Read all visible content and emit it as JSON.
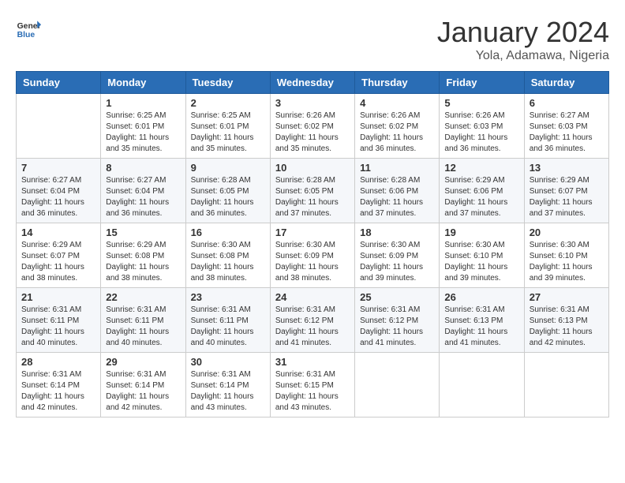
{
  "header": {
    "logo_line1": "General",
    "logo_line2": "Blue",
    "title": "January 2024",
    "subtitle": "Yola, Adamawa, Nigeria"
  },
  "calendar": {
    "days_of_week": [
      "Sunday",
      "Monday",
      "Tuesday",
      "Wednesday",
      "Thursday",
      "Friday",
      "Saturday"
    ],
    "weeks": [
      [
        {
          "day": "",
          "info": ""
        },
        {
          "day": "1",
          "info": "Sunrise: 6:25 AM\nSunset: 6:01 PM\nDaylight: 11 hours and 35 minutes."
        },
        {
          "day": "2",
          "info": "Sunrise: 6:25 AM\nSunset: 6:01 PM\nDaylight: 11 hours and 35 minutes."
        },
        {
          "day": "3",
          "info": "Sunrise: 6:26 AM\nSunset: 6:02 PM\nDaylight: 11 hours and 35 minutes."
        },
        {
          "day": "4",
          "info": "Sunrise: 6:26 AM\nSunset: 6:02 PM\nDaylight: 11 hours and 36 minutes."
        },
        {
          "day": "5",
          "info": "Sunrise: 6:26 AM\nSunset: 6:03 PM\nDaylight: 11 hours and 36 minutes."
        },
        {
          "day": "6",
          "info": "Sunrise: 6:27 AM\nSunset: 6:03 PM\nDaylight: 11 hours and 36 minutes."
        }
      ],
      [
        {
          "day": "7",
          "info": "Sunrise: 6:27 AM\nSunset: 6:04 PM\nDaylight: 11 hours and 36 minutes."
        },
        {
          "day": "8",
          "info": "Sunrise: 6:27 AM\nSunset: 6:04 PM\nDaylight: 11 hours and 36 minutes."
        },
        {
          "day": "9",
          "info": "Sunrise: 6:28 AM\nSunset: 6:05 PM\nDaylight: 11 hours and 36 minutes."
        },
        {
          "day": "10",
          "info": "Sunrise: 6:28 AM\nSunset: 6:05 PM\nDaylight: 11 hours and 37 minutes."
        },
        {
          "day": "11",
          "info": "Sunrise: 6:28 AM\nSunset: 6:06 PM\nDaylight: 11 hours and 37 minutes."
        },
        {
          "day": "12",
          "info": "Sunrise: 6:29 AM\nSunset: 6:06 PM\nDaylight: 11 hours and 37 minutes."
        },
        {
          "day": "13",
          "info": "Sunrise: 6:29 AM\nSunset: 6:07 PM\nDaylight: 11 hours and 37 minutes."
        }
      ],
      [
        {
          "day": "14",
          "info": "Sunrise: 6:29 AM\nSunset: 6:07 PM\nDaylight: 11 hours and 38 minutes."
        },
        {
          "day": "15",
          "info": "Sunrise: 6:29 AM\nSunset: 6:08 PM\nDaylight: 11 hours and 38 minutes."
        },
        {
          "day": "16",
          "info": "Sunrise: 6:30 AM\nSunset: 6:08 PM\nDaylight: 11 hours and 38 minutes."
        },
        {
          "day": "17",
          "info": "Sunrise: 6:30 AM\nSunset: 6:09 PM\nDaylight: 11 hours and 38 minutes."
        },
        {
          "day": "18",
          "info": "Sunrise: 6:30 AM\nSunset: 6:09 PM\nDaylight: 11 hours and 39 minutes."
        },
        {
          "day": "19",
          "info": "Sunrise: 6:30 AM\nSunset: 6:10 PM\nDaylight: 11 hours and 39 minutes."
        },
        {
          "day": "20",
          "info": "Sunrise: 6:30 AM\nSunset: 6:10 PM\nDaylight: 11 hours and 39 minutes."
        }
      ],
      [
        {
          "day": "21",
          "info": "Sunrise: 6:31 AM\nSunset: 6:11 PM\nDaylight: 11 hours and 40 minutes."
        },
        {
          "day": "22",
          "info": "Sunrise: 6:31 AM\nSunset: 6:11 PM\nDaylight: 11 hours and 40 minutes."
        },
        {
          "day": "23",
          "info": "Sunrise: 6:31 AM\nSunset: 6:11 PM\nDaylight: 11 hours and 40 minutes."
        },
        {
          "day": "24",
          "info": "Sunrise: 6:31 AM\nSunset: 6:12 PM\nDaylight: 11 hours and 41 minutes."
        },
        {
          "day": "25",
          "info": "Sunrise: 6:31 AM\nSunset: 6:12 PM\nDaylight: 11 hours and 41 minutes."
        },
        {
          "day": "26",
          "info": "Sunrise: 6:31 AM\nSunset: 6:13 PM\nDaylight: 11 hours and 41 minutes."
        },
        {
          "day": "27",
          "info": "Sunrise: 6:31 AM\nSunset: 6:13 PM\nDaylight: 11 hours and 42 minutes."
        }
      ],
      [
        {
          "day": "28",
          "info": "Sunrise: 6:31 AM\nSunset: 6:14 PM\nDaylight: 11 hours and 42 minutes."
        },
        {
          "day": "29",
          "info": "Sunrise: 6:31 AM\nSunset: 6:14 PM\nDaylight: 11 hours and 42 minutes."
        },
        {
          "day": "30",
          "info": "Sunrise: 6:31 AM\nSunset: 6:14 PM\nDaylight: 11 hours and 43 minutes."
        },
        {
          "day": "31",
          "info": "Sunrise: 6:31 AM\nSunset: 6:15 PM\nDaylight: 11 hours and 43 minutes."
        },
        {
          "day": "",
          "info": ""
        },
        {
          "day": "",
          "info": ""
        },
        {
          "day": "",
          "info": ""
        }
      ]
    ]
  }
}
